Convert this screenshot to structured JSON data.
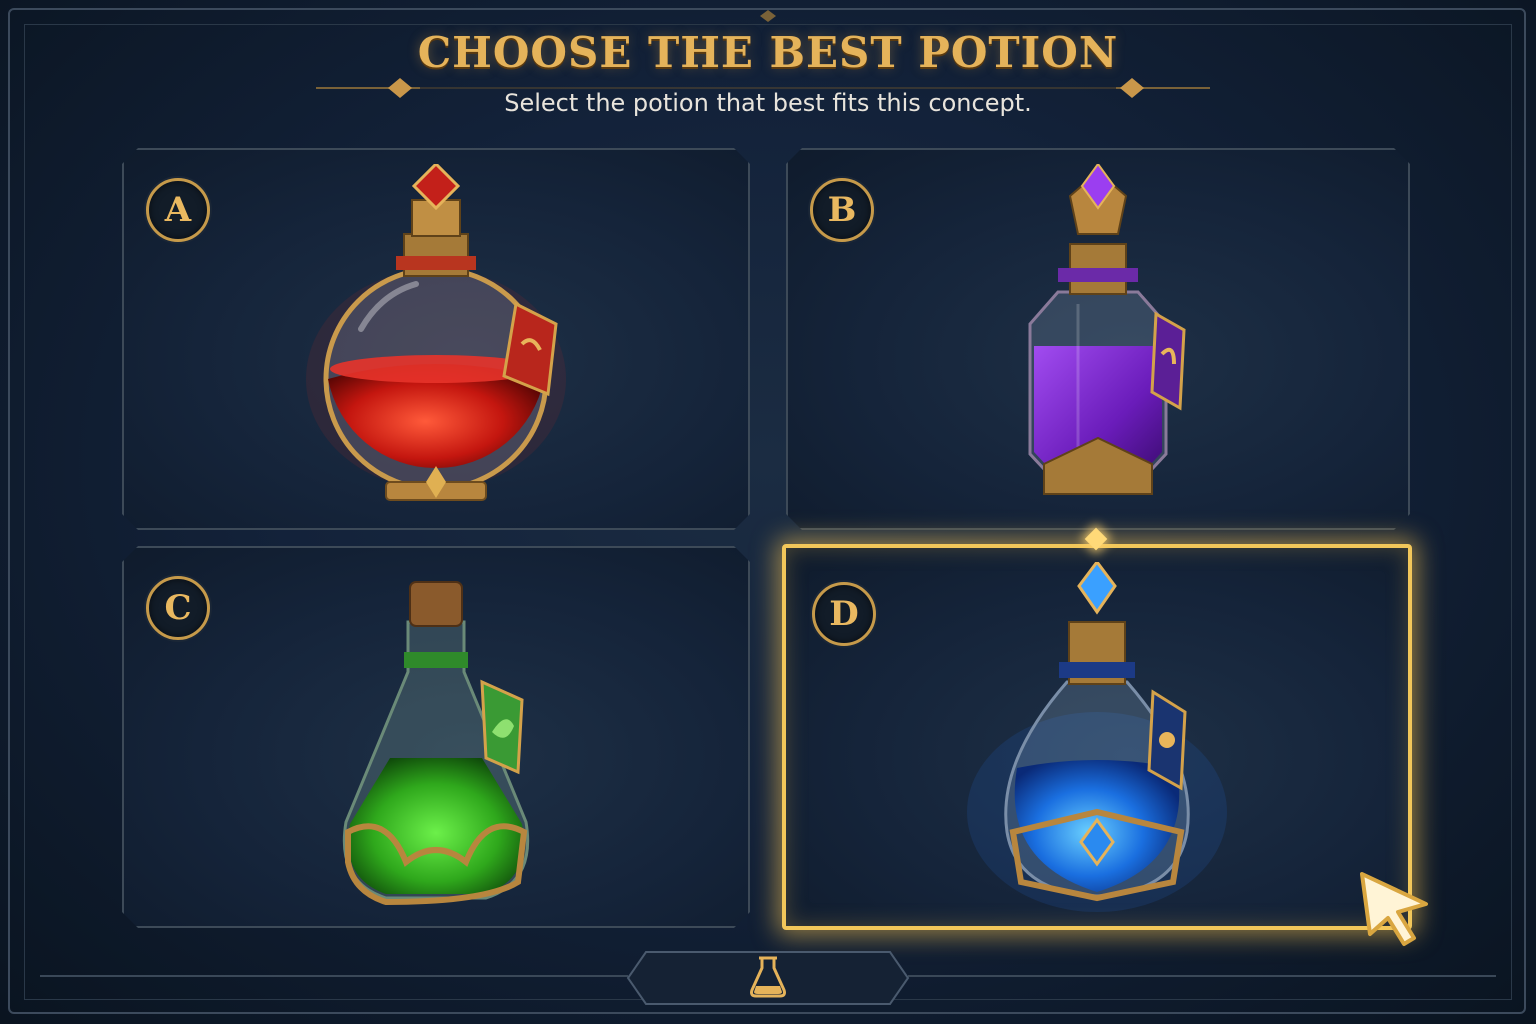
{
  "header": {
    "title": "CHOOSE THE BEST POTION",
    "subtitle": "Select the potion that best fits this concept."
  },
  "options": [
    {
      "letter": "A",
      "potion": "red-round-potion-icon",
      "liquid_color": "#d8231c",
      "selected": false
    },
    {
      "letter": "B",
      "potion": "purple-hexagonal-potion-icon",
      "liquid_color": "#7a26c9",
      "selected": false
    },
    {
      "letter": "C",
      "potion": "green-flask-potion-icon",
      "liquid_color": "#3fc42a",
      "selected": false
    },
    {
      "letter": "D",
      "potion": "blue-crystal-potion-icon",
      "liquid_color": "#1a6fe0",
      "selected": true
    }
  ],
  "footer": {
    "icon": "flask-icon"
  },
  "colors": {
    "accent_gold": "#e5b35a",
    "selection_glow": "#f2c75a",
    "background": "#13223a"
  }
}
